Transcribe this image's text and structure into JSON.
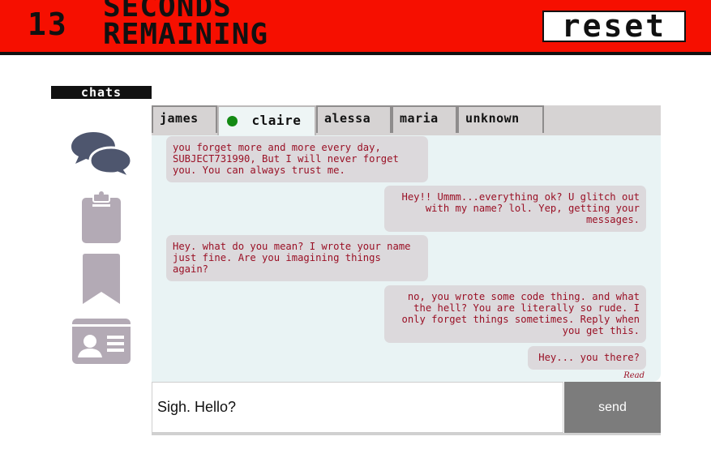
{
  "header": {
    "countdown_number": "13",
    "countdown_text": "SECONDS REMAINING",
    "reset_label": "reset"
  },
  "sidebar": {
    "section_label": "chats",
    "items": [
      {
        "name": "chats",
        "icon": "chat-bubbles-icon"
      },
      {
        "name": "clipboard",
        "icon": "clipboard-icon"
      },
      {
        "name": "bookmarks",
        "icon": "bookmark-icon"
      },
      {
        "name": "contacts",
        "icon": "id-card-icon"
      }
    ]
  },
  "tabs": [
    {
      "label": "james",
      "active": false,
      "online": false
    },
    {
      "label": "claire",
      "active": true,
      "online": true
    },
    {
      "label": "alessa",
      "active": false,
      "online": false
    },
    {
      "label": "maria",
      "active": false,
      "online": false
    },
    {
      "label": "unknown",
      "active": false,
      "online": false
    }
  ],
  "messages": [
    {
      "side": "left",
      "text": "you forget more and more every day,\nSUBJECT731990, But I will never forget\nyou. You can always trust me."
    },
    {
      "side": "right",
      "text": "Hey!! Ummm...everything ok? U glitch out\nwith my name? lol. Yep, getting your\nmessages."
    },
    {
      "side": "left",
      "text": "Hey. what do you mean? I wrote your name\njust fine. Are you imagining things\nagain?"
    },
    {
      "side": "right",
      "text": "no, you wrote some code thing. and what\nthe hell? You are literally so rude. I\nonly forget things sometimes. Reply when\nyou get this."
    },
    {
      "side": "right",
      "text": "Hey... you there?"
    }
  ],
  "read_receipt": "Read",
  "composer": {
    "value": "Sigh. Hello?",
    "send_label": "send"
  },
  "colors": {
    "banner": "#f60f00",
    "message_text": "#9a1025",
    "bubble": "#dcd9dc",
    "chat_bg": "#e9f3f4",
    "online": "#138a13",
    "icon": "#b3aab5",
    "chat_icon": "#4e566e"
  }
}
